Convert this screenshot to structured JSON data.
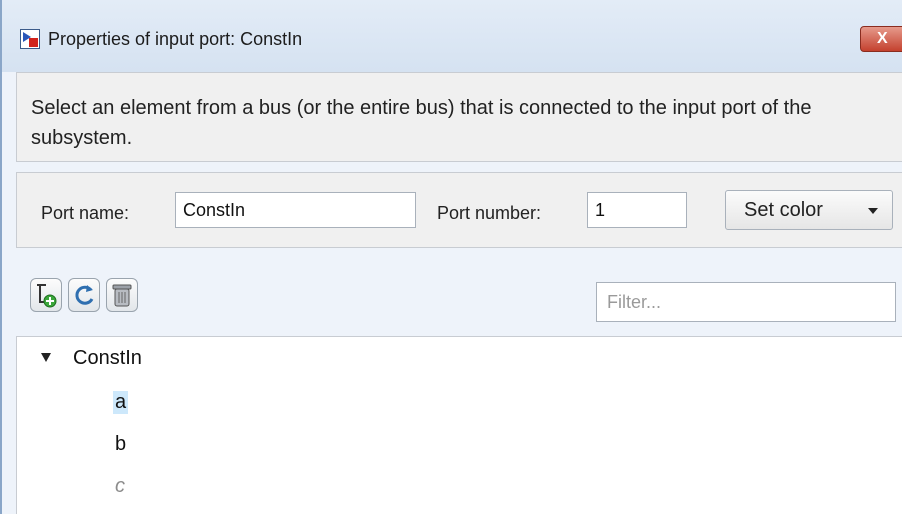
{
  "window": {
    "title": "Properties of input port: ConstIn",
    "close_label": "X"
  },
  "description": "Select an element from a bus (or the entire bus) that is connected to the input port of the subsystem.",
  "port": {
    "name_label": "Port name:",
    "name_value": "ConstIn",
    "number_label": "Port number:",
    "number_value": "1",
    "set_color_label": "Set color"
  },
  "toolbar": {
    "icons": [
      "add-element-icon",
      "refresh-icon",
      "trash-icon"
    ]
  },
  "filter": {
    "placeholder": "Filter..."
  },
  "tree": {
    "root": "ConstIn",
    "root_expanded": true,
    "children": [
      {
        "label": "a",
        "selected": true,
        "available": true
      },
      {
        "label": "b",
        "selected": false,
        "available": true
      },
      {
        "label": "c",
        "selected": false,
        "available": false
      }
    ]
  },
  "colors": {
    "selection": "#cde8fb",
    "close_button": "#c4412e",
    "window_border": "#8aa6c8"
  }
}
